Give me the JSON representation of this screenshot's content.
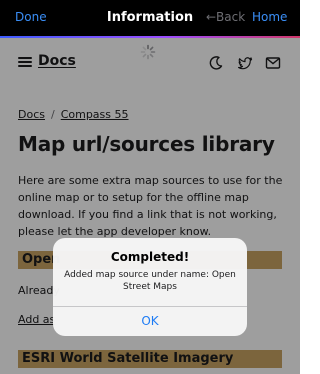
{
  "topbar": {
    "done_label": "Done",
    "title": "Information",
    "back_label": "←Back",
    "home_label": "Home",
    "done_color": "#3a8ef6"
  },
  "navbar": {
    "brand": "Docs",
    "icons": [
      "menu-icon",
      "moon-icon",
      "twitter-icon",
      "mail-icon"
    ]
  },
  "breadcrumb": {
    "items": [
      "Docs",
      "Compass 55"
    ],
    "separator": "/"
  },
  "page": {
    "title": "Map url/sources library",
    "intro": "Here are some extra map sources to use for the online map or to setup for the offline map download. If you find a link that is not working, please let the app developer know.",
    "section1_title": "Open",
    "section1_line": "Already",
    "section1_link": "Add as",
    "section2_title": "ESRI World Satellite Imagery",
    "section_color": "#c8a463"
  },
  "alert": {
    "title": "Completed!",
    "message": "Added map source under name: Open Street Maps",
    "ok_label": "OK",
    "ok_color": "#1e7cf5"
  }
}
